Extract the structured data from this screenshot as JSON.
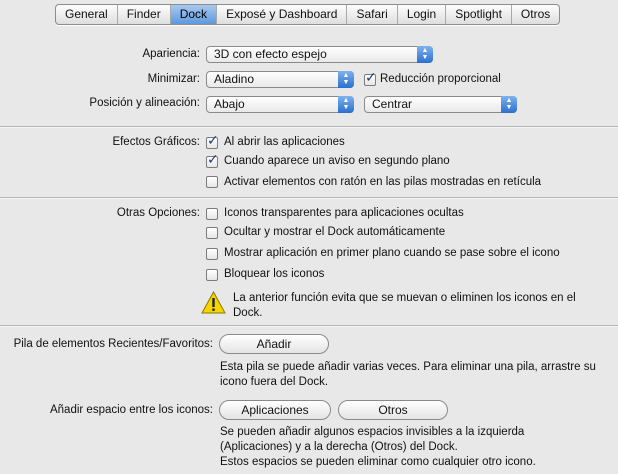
{
  "tabs": [
    "General",
    "Finder",
    "Dock",
    "Exposé y Dashboard",
    "Safari",
    "Login",
    "Spotlight",
    "Otros"
  ],
  "active_tab": "Dock",
  "appearance": {
    "label": "Apariencia:",
    "value": "3D con efecto espejo"
  },
  "minimize": {
    "label": "Minimizar:",
    "value": "Aladino",
    "checkbox_label": "Reducción proporcional",
    "checked": true
  },
  "position": {
    "label": "Posición y alineación:",
    "value": "Abajo",
    "align_value": "Centrar"
  },
  "effects": {
    "label": "Efectos Gráficos:",
    "options": [
      {
        "label": "Al abrir las aplicaciones",
        "checked": true
      },
      {
        "label": "Cuando aparece un aviso en segundo plano",
        "checked": true
      },
      {
        "label": "Activar elementos con ratón en las pilas mostradas en retícula",
        "checked": false
      }
    ]
  },
  "other": {
    "label": "Otras Opciones:",
    "options": [
      {
        "label": "Iconos transparentes para aplicaciones ocultas",
        "checked": false
      },
      {
        "label": "Ocultar y mostrar el Dock automáticamente",
        "checked": false
      },
      {
        "label": "Mostrar aplicación en primer plano cuando se pase sobre el icono",
        "checked": false
      },
      {
        "label": "Bloquear los iconos",
        "checked": false
      }
    ],
    "warning_line1": "La anterior función evita que se muevan o eliminen los iconos en el",
    "warning_line2": "Dock."
  },
  "stack": {
    "label": "Pila de elementos Recientes/Favoritos:",
    "button": "Añadir",
    "note_line1": "Esta pila se puede añadir varias veces. Para eliminar una pila, arrastre su",
    "note_line2": "icono fuera del Dock."
  },
  "spacer": {
    "label": "Añadir espacio entre los iconos:",
    "button_apps": "Aplicaciones",
    "button_other": "Otros",
    "note_line1": "Se pueden añadir algunos espacios invisibles a la izquierda",
    "note_line2": "(Aplicaciones) y a la derecha (Otros) del Dock.",
    "note_line3": "Estos espacios se pueden eliminar como cualquier otro icono."
  }
}
